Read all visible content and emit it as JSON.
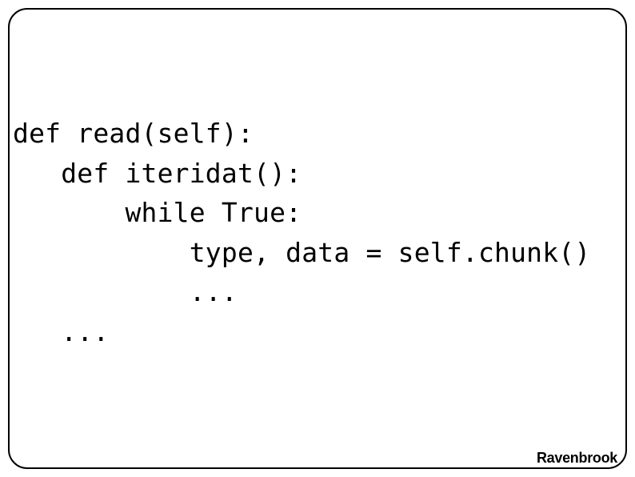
{
  "code": {
    "line1": "def read(self):",
    "line2": "   def iteridat():",
    "line3": "       while True:",
    "line4": "           type, data = self.chunk()",
    "line5": "           ...",
    "line6": "   ..."
  },
  "footer": "Ravenbrook"
}
